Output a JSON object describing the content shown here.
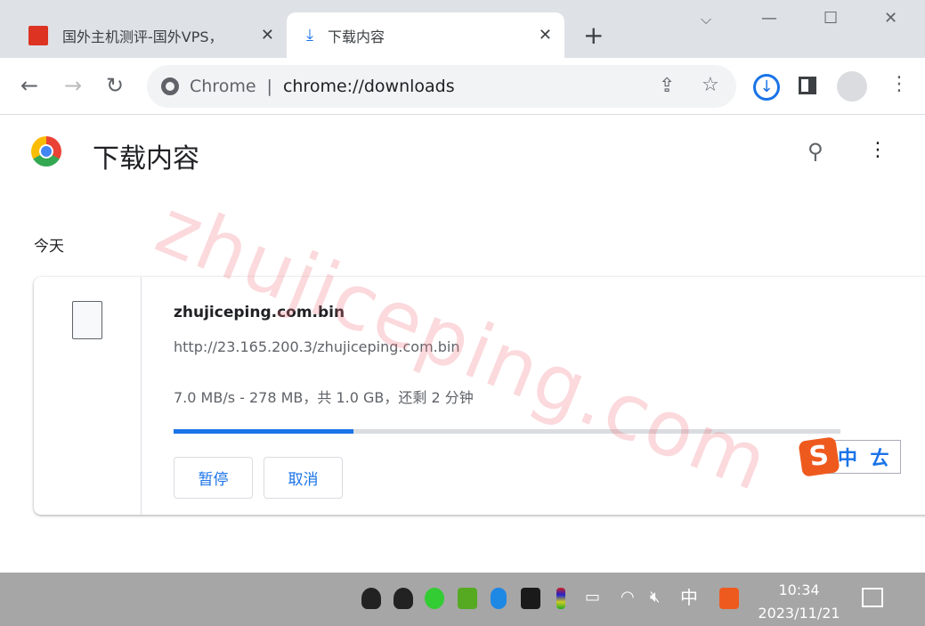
{
  "tabs": [
    {
      "title": "国外主机测评-国外VPS，",
      "icon": "site-favicon"
    },
    {
      "title": "下载内容",
      "icon": "download-icon"
    }
  ],
  "omnibox": {
    "site": "Chrome",
    "url": "chrome://downloads"
  },
  "page": {
    "title": "下载内容",
    "section": "今天"
  },
  "download": {
    "filename": "zhujiceping.com.bin",
    "url": "http://23.165.200.3/zhujiceping.com.bin",
    "status": "7.0 MB/s - 278 MB，共 1.0 GB，还剩 2 分钟",
    "progress_percent": 27,
    "pause": "暂停",
    "cancel": "取消"
  },
  "watermark": "zhujiceping.com",
  "ime": {
    "mode": "中",
    "extra": "ㄊ"
  },
  "taskbar": {
    "ime": "中",
    "time": "10:34",
    "date": "2023/11/21"
  },
  "colors": {
    "accent": "#1a73e8",
    "taskbar": "#a6a6a6"
  }
}
